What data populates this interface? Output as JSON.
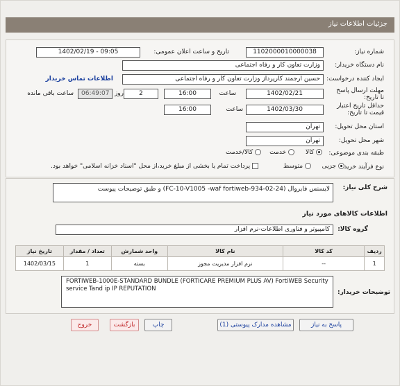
{
  "header": {
    "title": "جزئیات اطلاعات نیاز"
  },
  "fields": {
    "need_number": {
      "label": "شماره نیاز:",
      "value": "1102000010000038"
    },
    "announce": {
      "label": "تاریخ و ساعت اعلان عمومی:",
      "value": "1402/02/19 - 09:05"
    },
    "buyer_org": {
      "label": "نام دستگاه خریدار:",
      "value": "وزارت تعاون کار و رفاه اجتماعی"
    },
    "creator": {
      "label": "ایجاد کننده درخواست:",
      "value": "حسین ارجمند کارپرداز وزارت تعاون کار و رفاه اجتماعی",
      "contact_link": "اطلاعات تماس خریدار"
    },
    "deadline": {
      "label": "مهلت ارسال پاسخ تا تاریخ:",
      "date": "1402/02/21",
      "time_label": "ساعت",
      "time": "16:00",
      "days": "2",
      "days_label": "روز و",
      "remaining": "06:49:07",
      "remaining_label": "ساعت باقی مانده"
    },
    "validity": {
      "label": "حداقل تاریخ اعتبار قیمت تا تاریخ:",
      "date": "1402/03/30",
      "time_label": "ساعت",
      "time": "16:00"
    },
    "province": {
      "label": "استان محل تحویل:",
      "value": "تهران"
    },
    "city": {
      "label": "شهر محل تحویل:",
      "value": "تهران"
    },
    "category": {
      "label": "طبقه بندی موضوعی:",
      "options": [
        "کالا",
        "خدمت",
        "کالا/خدمت"
      ],
      "selected": "کالا"
    },
    "process": {
      "label": "نوع فرآیند خرید :",
      "options": [
        "جزیی",
        "متوسط"
      ],
      "selected": "جزیی",
      "note": "پرداخت تمام یا بخشی از مبلغ خرید،از محل \"اسناد خزانه اسلامی\" خواهد بود."
    }
  },
  "summary": {
    "label": "شرح کلی نیاز:",
    "value": "لایسنس  فایروال (24-02-934-FC-10-V1005 -waf fortiweb)  و طبق توضیحات پیوست"
  },
  "goods_info_title": "اطلاعات کالاهای مورد نیاز",
  "goods_group": {
    "label": "گروه کالا:",
    "value": "کامپیوتر و فناوری اطلاعات-نرم افزار"
  },
  "table": {
    "headers": [
      "ردیف",
      "کد کالا",
      "نام کالا",
      "واحد شمارش",
      "تعداد / مقدار",
      "تاریخ نیاز"
    ],
    "rows": [
      [
        "1",
        "--",
        "نرم افزار مدیریت مجوز",
        "بسته",
        "1",
        "1402/03/15"
      ]
    ]
  },
  "buyer_desc": {
    "label": "توضیحات خریدار:",
    "value": "FORTIWEB-1000E-STANDARD BUNDLE (FORTICARE PREMIUM PLUS AV) FortiWEB Security service Tand ip IP REPUTATION"
  },
  "buttons": {
    "reply": "پاسخ به نیاز",
    "docs": "مشاهده مدارک پیوستی (1)",
    "print": "چاپ",
    "back": "بازگشت",
    "exit": "خروج"
  }
}
